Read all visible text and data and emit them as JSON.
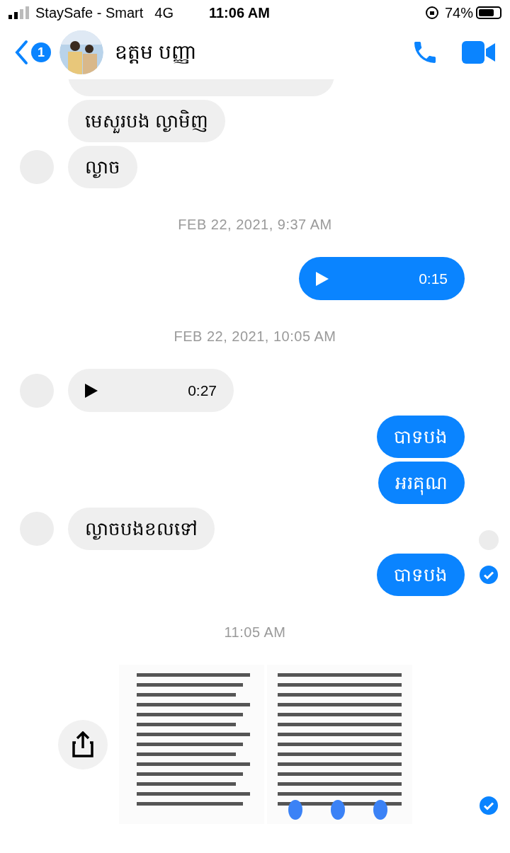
{
  "status_bar": {
    "carrier": "StaySafe - Smart",
    "network": "4G",
    "time": "11:06 AM",
    "battery": "74%"
  },
  "header": {
    "unread": "1",
    "name": "ឧត្តម បញ្ញា"
  },
  "messages": [
    {
      "kind": "text_in",
      "avatar": false
    },
    {
      "kind": "text_in",
      "text": "មេសួរបង ល្ងាមិញ",
      "avatar": false
    },
    {
      "kind": "text_in",
      "text": "ល្ងាច",
      "avatar": true
    },
    {
      "kind": "time",
      "text": "FEB 22, 2021, 9:37 AM"
    },
    {
      "kind": "voice_out",
      "text": "0:15"
    },
    {
      "kind": "time",
      "text": "FEB 22, 2021, 10:05 AM"
    },
    {
      "kind": "voice_in",
      "text": "0:27",
      "avatar": true
    },
    {
      "kind": "text_out",
      "text": "បាទបង"
    },
    {
      "kind": "text_out",
      "text": "អរគុណ"
    },
    {
      "kind": "text_in",
      "text": "ល្ងាចបងខលទៅ",
      "avatar": true,
      "seen_marker": true
    },
    {
      "kind": "text_out",
      "text": "បាទបង",
      "delivered": true
    },
    {
      "kind": "time",
      "text": "11:05 AM"
    },
    {
      "kind": "images",
      "delivered": true
    }
  ]
}
